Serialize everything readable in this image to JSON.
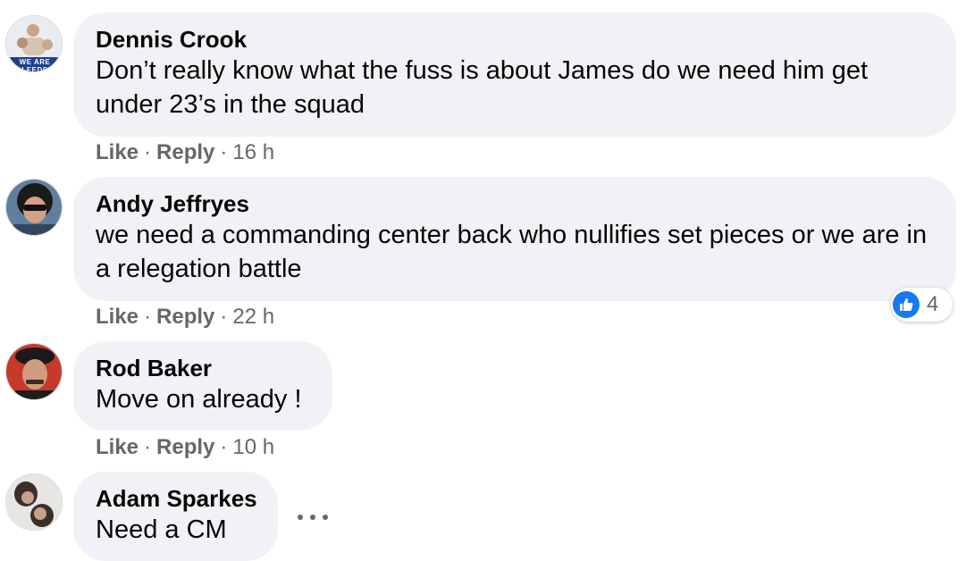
{
  "comments": [
    {
      "author": "Dennis Crook",
      "text": "Don’t really know what the fuss is about James do we need him get under 23’s in the squad",
      "like": "Like",
      "reply": "Reply",
      "time": "16 h",
      "avatar_caption": "WE ARE LEEDS"
    },
    {
      "author": "Andy Jeffryes",
      "text": "we need a commanding center back who nullifies set pieces or we are in a relegation battle",
      "like": "Like",
      "reply": "Reply",
      "time": "22 h",
      "reaction_count": "4",
      "reaction_icon": "like-icon"
    },
    {
      "author": "Rod Baker",
      "text": "Move on already !",
      "like": "Like",
      "reply": "Reply",
      "time": "10 h"
    },
    {
      "author": "Adam Sparkes",
      "text": "Need a CM"
    }
  ],
  "colors": {
    "bubble": "#f0f2f5",
    "meta": "#65676b",
    "like_blue": "#1877f2"
  },
  "icons": {
    "more": "more-options-icon"
  }
}
